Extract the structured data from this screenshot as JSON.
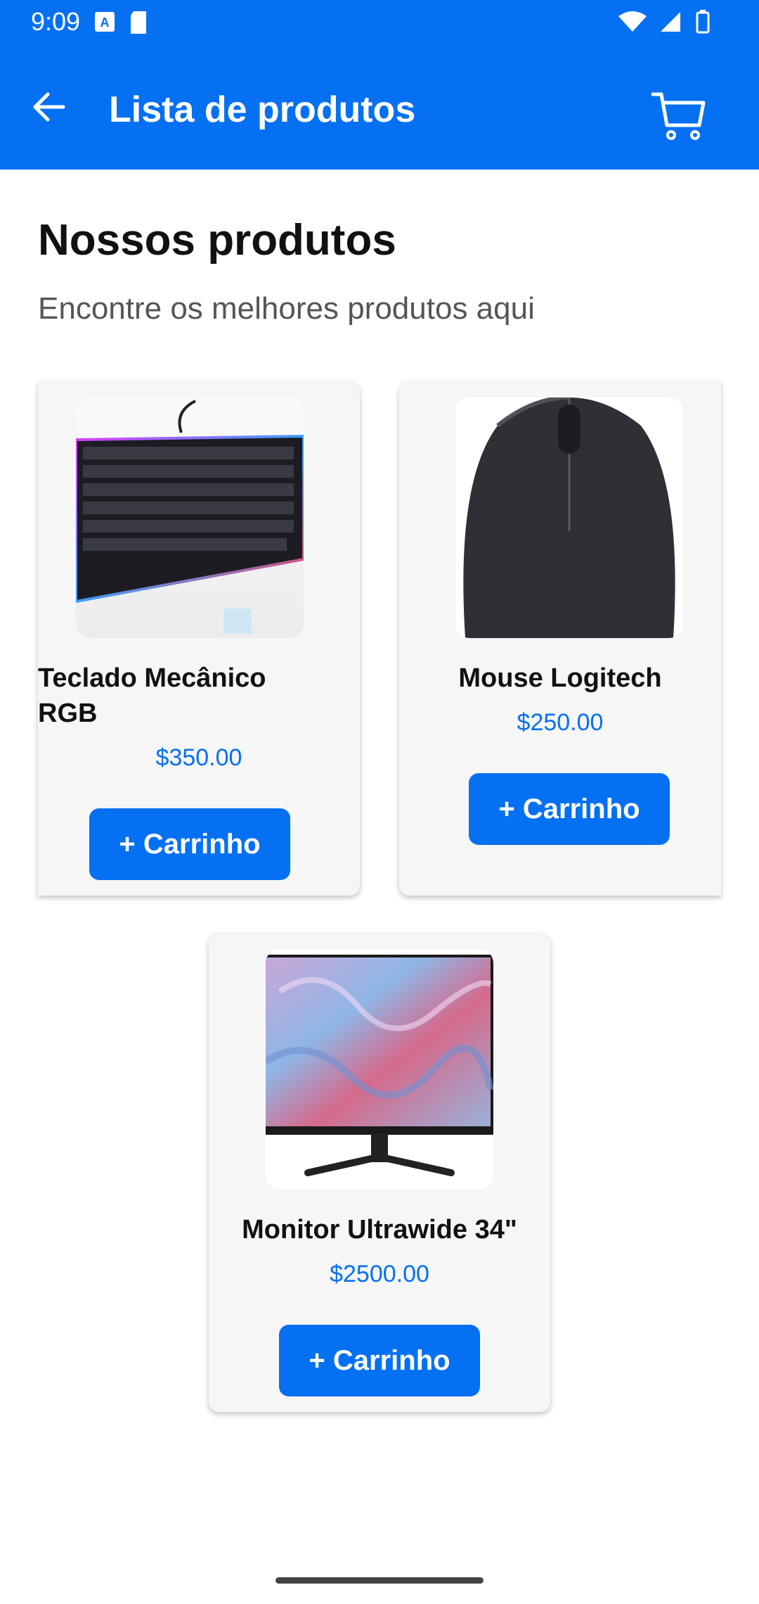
{
  "status_bar": {
    "time": "9:09"
  },
  "app_bar": {
    "title": "Lista de produtos"
  },
  "page": {
    "heading": "Nossos produtos",
    "subheading": "Encontre os melhores produtos aqui"
  },
  "products": [
    {
      "name": "Teclado Mecânico RGB",
      "price": "$350.00",
      "button": "+ Carrinho"
    },
    {
      "name": "Mouse Logitech",
      "price": "$250.00",
      "button": "+ Carrinho"
    },
    {
      "name": "Monitor Ultrawide 34\"",
      "price": "$2500.00",
      "button": "+ Carrinho"
    }
  ],
  "colors": {
    "primary": "#0570f2",
    "card_bg": "#f6f6f6"
  }
}
